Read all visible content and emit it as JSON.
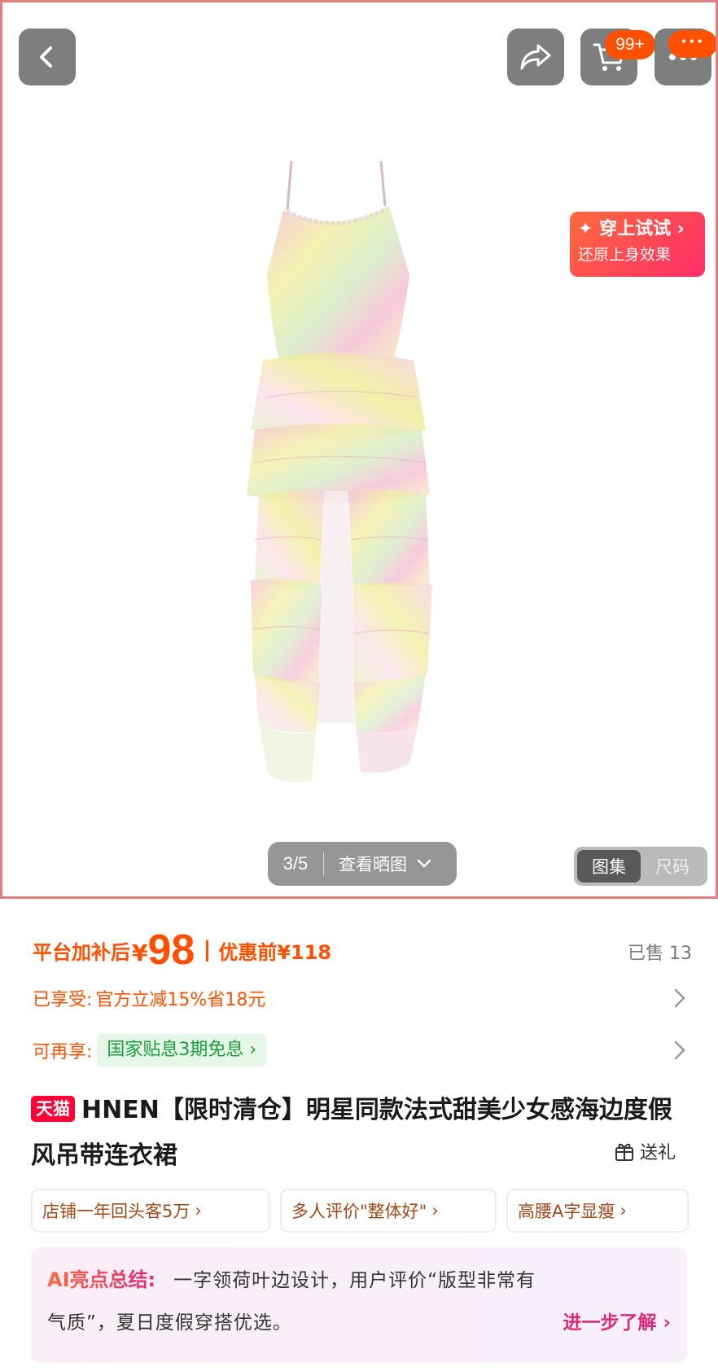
{
  "gallery": {
    "cart_badge": "99+",
    "more_badge": "···",
    "try_on": {
      "title": "✦ 穿上试试 ›",
      "subtitle": "还原上身效果"
    },
    "page_index": "3/5",
    "view_label": "查看晒图",
    "segments": {
      "active": "图集",
      "inactive": "尺码"
    }
  },
  "price": {
    "prefix": "平台加补后",
    "currency": "¥",
    "amount": "98",
    "original_label": "优惠前¥118",
    "sold": "已售 13",
    "color": "#ff5000"
  },
  "benefits": {
    "row1": {
      "label": "已享受:",
      "text": "官方立减15%省18元"
    },
    "row2": {
      "label": "可再享:",
      "tag": "国家贴息3期免息 ›"
    }
  },
  "product": {
    "store_badge": "天猫",
    "title": "HNEN【限时清仓】明星同款法式甜美少女感海边度假风吊带连衣裙",
    "gift": "送礼"
  },
  "tags": [
    "店铺一年回头客5万",
    "多人评价\"整体好\"",
    "高腰A字显瘦"
  ],
  "ai_summary": {
    "label": "AI亮点总结:",
    "line1": "一字领荷叶边设计，用户评价“版型非常有",
    "line2": "气质”，夏日度假穿搭优选。",
    "more": "进一步了解 ›"
  },
  "icons": {
    "back": "chevron-left-icon",
    "share": "share-icon",
    "cart": "cart-icon",
    "more": "more-icon",
    "gift": "gift-icon"
  }
}
